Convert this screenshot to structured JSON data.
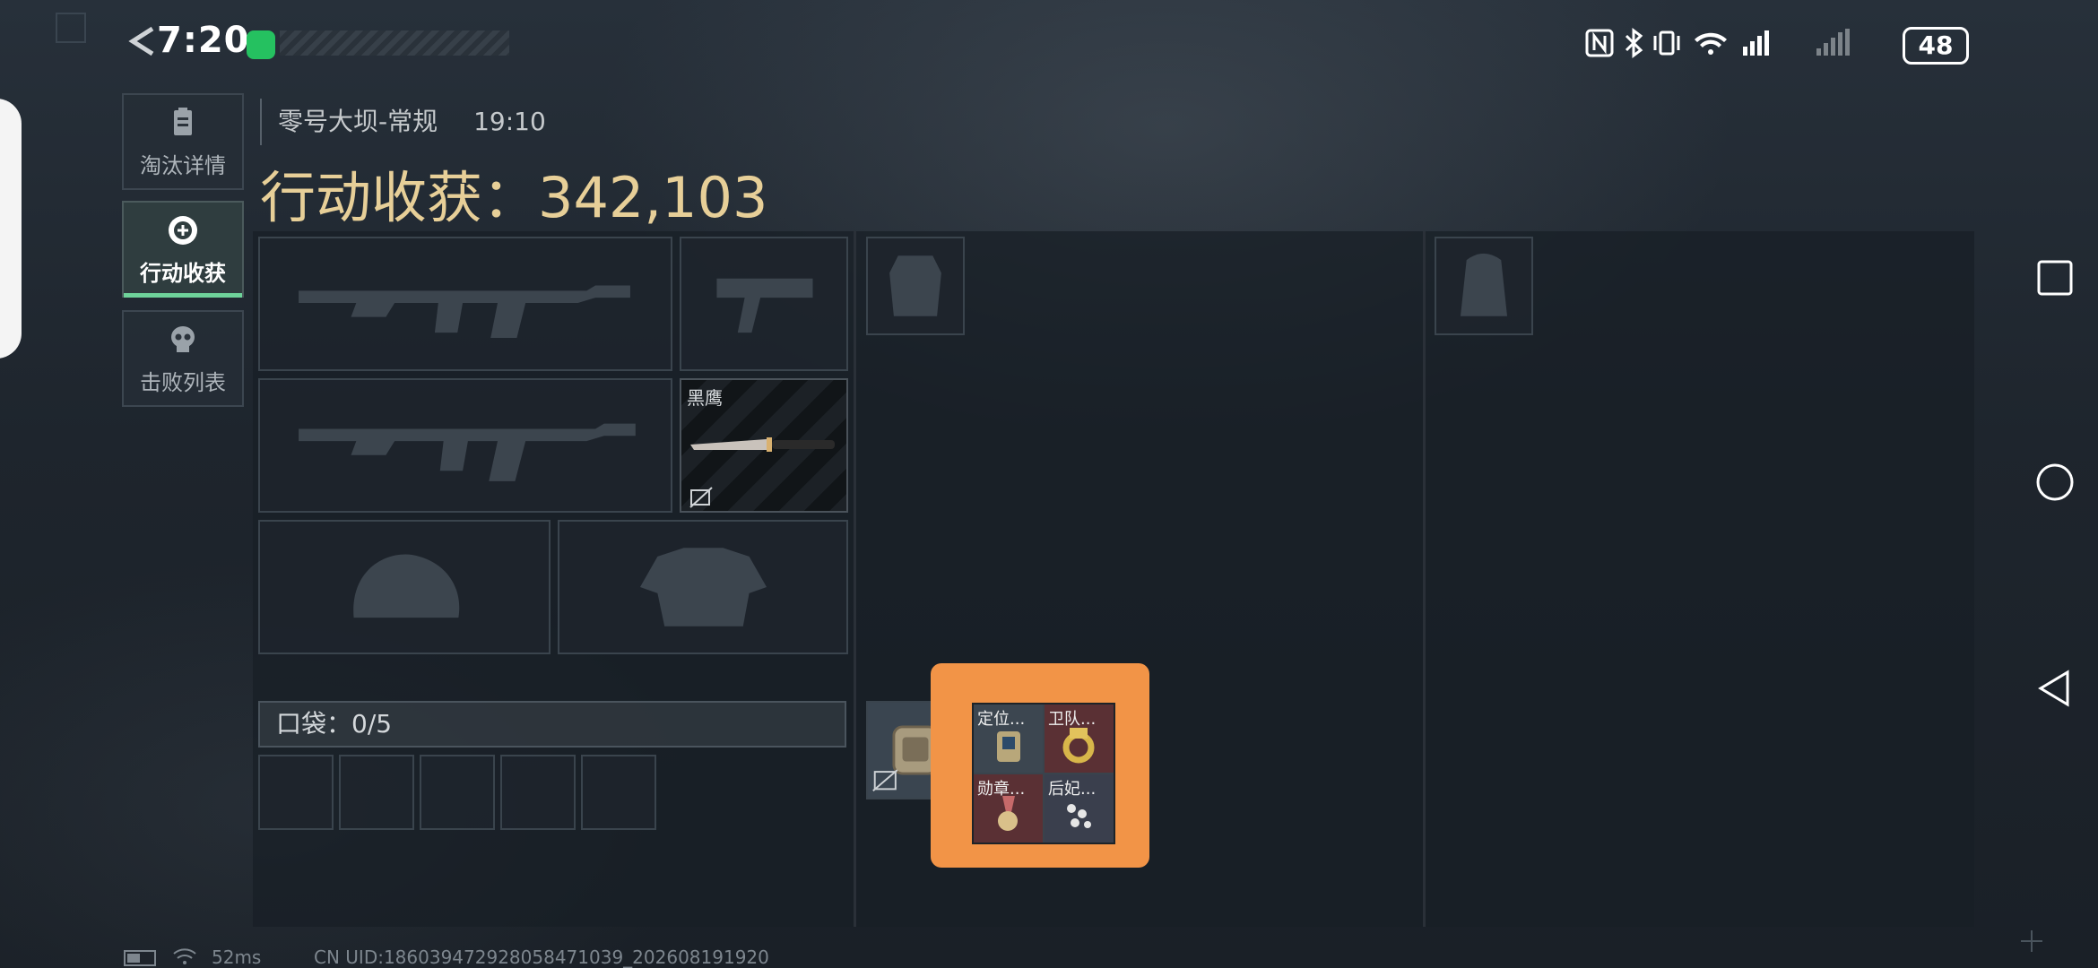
{
  "status_bar": {
    "time": "7:20",
    "battery": "48"
  },
  "side_tabs": [
    {
      "label": "淘汰详情",
      "icon": "clipboard-icon",
      "active": false
    },
    {
      "label": "行动收获",
      "icon": "target-icon",
      "active": true
    },
    {
      "label": "击败列表",
      "icon": "skull-icon",
      "active": false
    }
  ],
  "header": {
    "map": "零号大坝-常规",
    "time": "19:10",
    "harvest_label": "行动收获：",
    "harvest_value": "342,103"
  },
  "equipment": {
    "melee_name": "黑鹰"
  },
  "pocket": {
    "label": "口袋：",
    "count": "0/5"
  },
  "case_items": [
    {
      "name": "定位..."
    },
    {
      "name": "卫队..."
    },
    {
      "name": "勋章..."
    },
    {
      "name": "后妃..."
    }
  ],
  "footer": {
    "ping": "52ms",
    "uid": "CN UID:186039472928058471039_202608191920"
  },
  "colors": {
    "accent": "#e7cf98",
    "highlight": "#f29447",
    "active_tab": "#6ed39a"
  }
}
